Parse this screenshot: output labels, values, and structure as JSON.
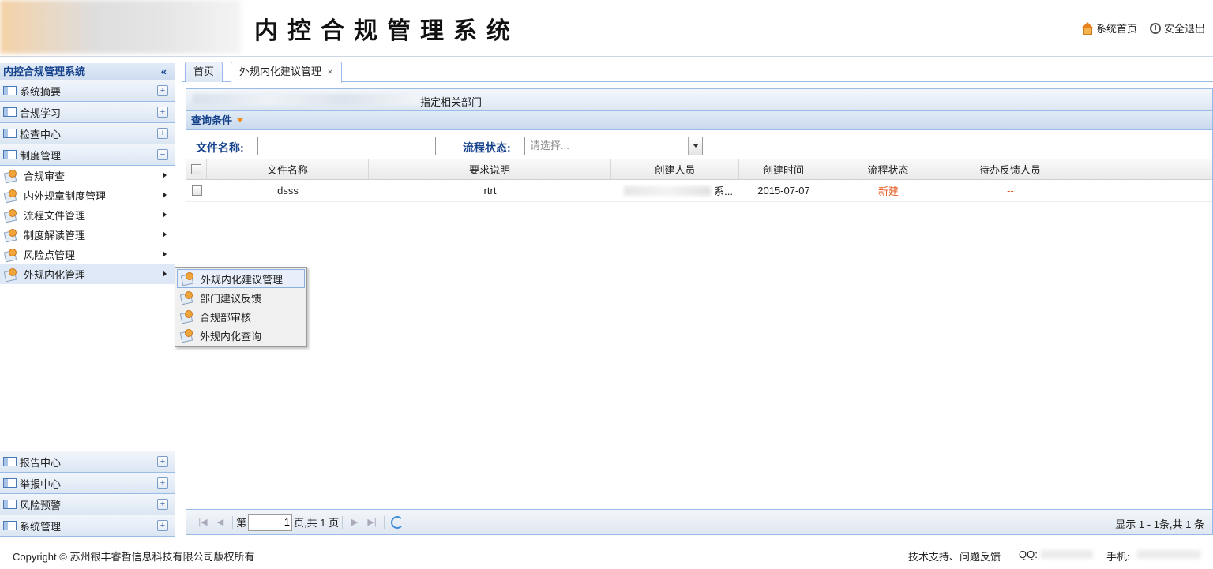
{
  "header": {
    "title": "内控合规管理系统",
    "home_link": "系统首页",
    "logout_link": "安全退出"
  },
  "sidebar": {
    "title": "内控合规管理系统",
    "collapse_glyph": "«",
    "sections_top": [
      {
        "label": "系统摘要",
        "toggle": "+"
      },
      {
        "label": "合规学习",
        "toggle": "+"
      },
      {
        "label": "检查中心",
        "toggle": "+"
      },
      {
        "label": "制度管理",
        "toggle": "−"
      }
    ],
    "sub_items": [
      {
        "label": "合规审查"
      },
      {
        "label": "内外规章制度管理"
      },
      {
        "label": "流程文件管理"
      },
      {
        "label": "制度解读管理"
      },
      {
        "label": "风险点管理"
      },
      {
        "label": "外规内化管理"
      }
    ],
    "sections_bottom": [
      {
        "label": "报告中心",
        "toggle": "+"
      },
      {
        "label": "举报中心",
        "toggle": "+"
      },
      {
        "label": "风险预警",
        "toggle": "+"
      },
      {
        "label": "系统管理",
        "toggle": "+"
      }
    ]
  },
  "flyout": {
    "items": [
      {
        "label": "外规内化建议管理"
      },
      {
        "label": "部门建议反馈"
      },
      {
        "label": "合规部审核"
      },
      {
        "label": "外规内化查询"
      }
    ]
  },
  "tabs": [
    {
      "label": "首页"
    },
    {
      "label": "外规内化建议管理",
      "close": "×"
    }
  ],
  "panel": {
    "title": "指定相关部门",
    "query_header": "查询条件",
    "file_name_label": "文件名称:",
    "file_name_value": "",
    "state_label": "流程状态:",
    "state_placeholder": "请选择..."
  },
  "grid": {
    "columns": [
      "文件名称",
      "要求说明",
      "创建人员",
      "创建时间",
      "流程状态",
      "待办反馈人员"
    ],
    "rows": [
      {
        "file_name": "dsss",
        "requirement": "rtrt",
        "creator": "系...",
        "created": "2015-07-07",
        "state": "新建",
        "pending": "--"
      }
    ]
  },
  "pager": {
    "page_prefix": "第",
    "page_value": "1",
    "page_suffix": "页,共 1 页",
    "info": "显示 1 - 1条,共 1 条"
  },
  "footer": {
    "copyright": "Copyright © 苏州银丰睿哲信息科技有限公司版权所有",
    "support": "技术支持、问题反馈",
    "qq_label": "QQ:",
    "phone_label": "手机:"
  },
  "colors": {
    "accent": "#15428b",
    "border": "#99bbe8",
    "status_new": "#e6571d"
  }
}
